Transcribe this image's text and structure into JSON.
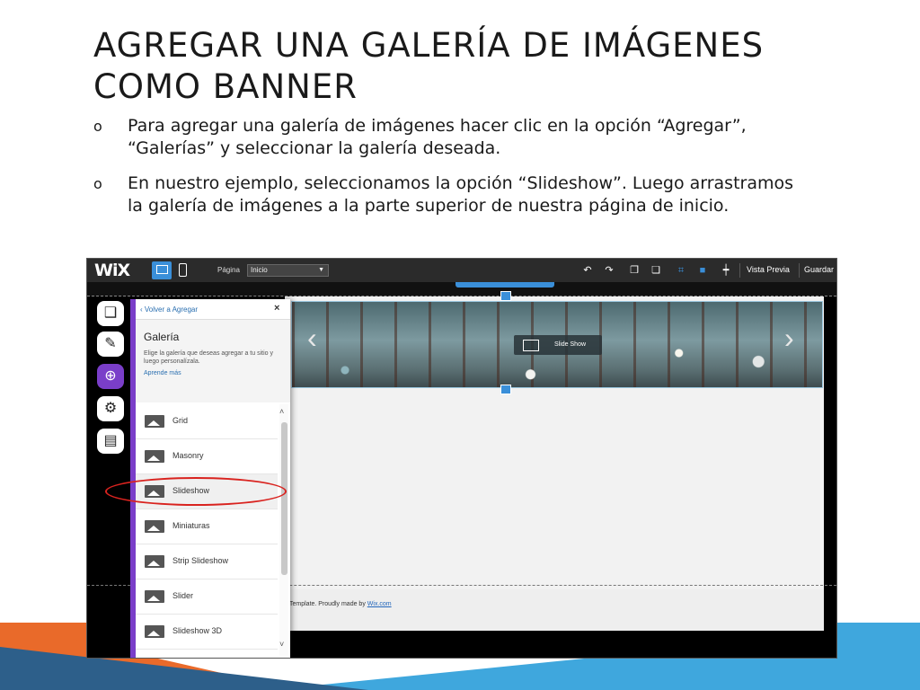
{
  "slide": {
    "title_line1": "AGREGAR UNA GALERÍA DE IMÁGENES",
    "title_line2": "COMO BANNER",
    "bullet_mark": "o",
    "bullets": [
      "Para agregar una galería de imágenes hacer clic en la opción “Agregar”, “Galerías” y seleccionar la galería deseada.",
      "En nuestro ejemplo, seleccionamos la opción “Slideshow”. Luego arrastramos la galería de imágenes a la parte superior de nuestra página de inicio."
    ]
  },
  "editor": {
    "logo": "WiX",
    "page_label": "Página",
    "page_value": "Inicio",
    "preview_label": "Vista Previa",
    "save_label": "Guardar",
    "slideshow_badge": "Slide Show",
    "footer_text": "Template. Proudly made by",
    "footer_link": "Wix.com"
  },
  "panel": {
    "back_label": "Volver a Agregar",
    "close": "×",
    "title": "Galería",
    "description": "Elige la galería que deseas agregar a tu sitio y luego personalízala.",
    "learn_more": "Aprende más",
    "options": [
      "Grid",
      "Masonry",
      "Slideshow",
      "Miniaturas",
      "Strip Slideshow",
      "Slider",
      "Slideshow 3D"
    ],
    "selected": "Slideshow"
  },
  "colors": {
    "accent_purple": "#7a3ec9",
    "wix_blue": "#3a8fd9",
    "highlight_red": "#d9231f",
    "deco_orange": "#e96a2a",
    "deco_blue": "#3fa7dd"
  },
  "icons": [
    "desktop-icon",
    "mobile-icon",
    "undo-icon",
    "redo-icon",
    "copy-icon",
    "paste-icon",
    "pages-icon",
    "design-icon",
    "add-icon",
    "settings-icon",
    "store-icon",
    "chevron-left-icon",
    "chevron-right-icon"
  ]
}
